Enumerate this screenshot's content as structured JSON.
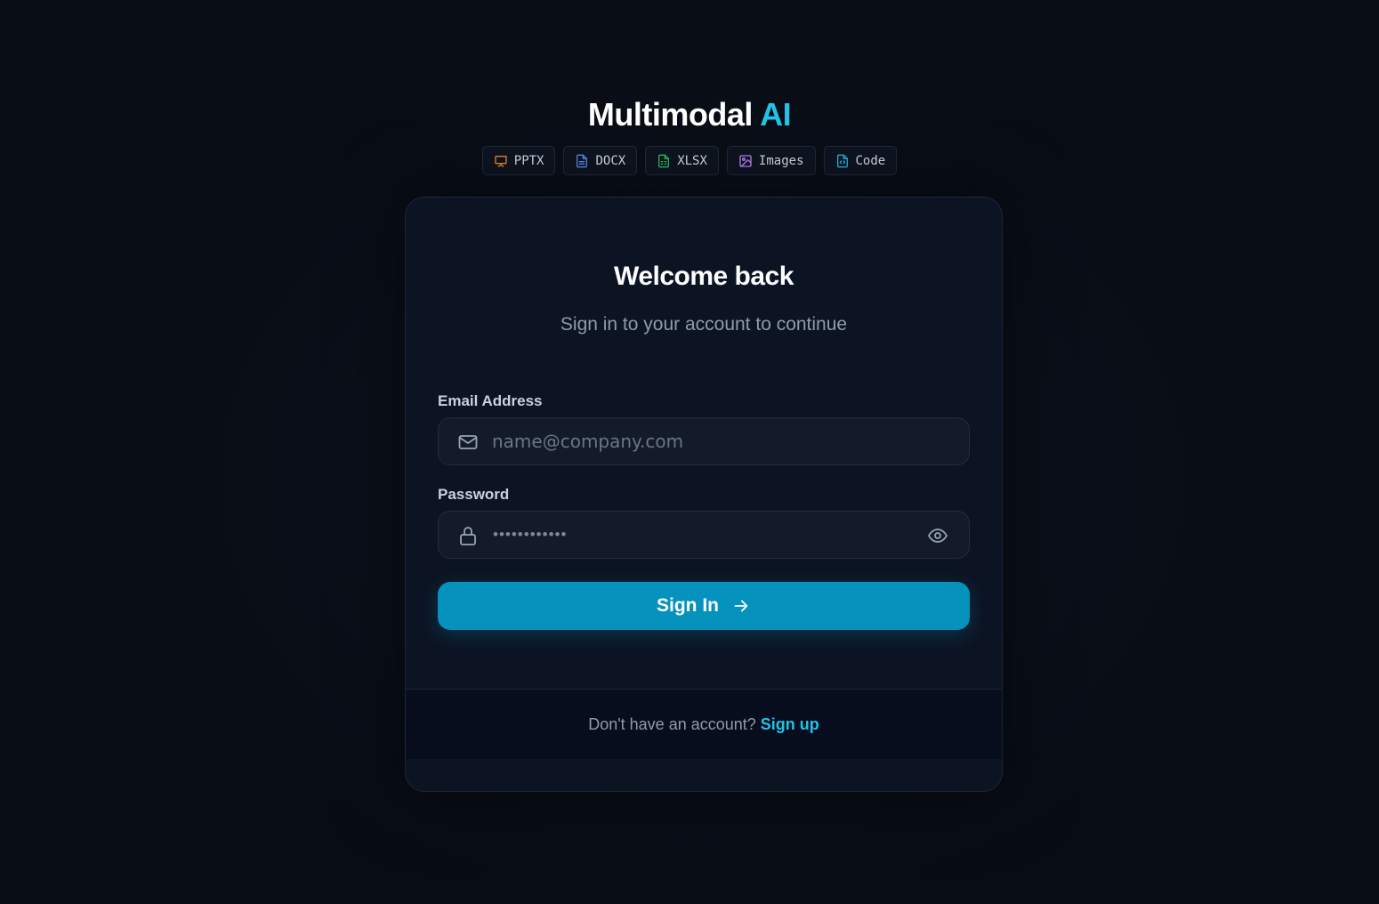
{
  "brand": {
    "name": "Multimodal",
    "accent": "AI",
    "accent_color": "#22c3e6"
  },
  "chips": [
    {
      "label": "PPTX",
      "icon": "presentation-icon",
      "color": "#f28c28"
    },
    {
      "label": "DOCX",
      "icon": "document-icon",
      "color": "#5b8def"
    },
    {
      "label": "XLSX",
      "icon": "spreadsheet-icon",
      "color": "#22c55e"
    },
    {
      "label": "Images",
      "icon": "image-icon",
      "color": "#c084fc"
    },
    {
      "label": "Code",
      "icon": "code-file-icon",
      "color": "#22b8e6"
    }
  ],
  "card": {
    "title": "Welcome back",
    "subtitle": "Sign in to your account to continue",
    "email": {
      "label": "Email Address",
      "placeholder": "name@company.com",
      "value": "",
      "icon": "mail-icon"
    },
    "password": {
      "label": "Password",
      "value_masked": "••••••••••••",
      "icon": "lock-icon",
      "toggle_icon": "eye-icon"
    },
    "submit": {
      "label": "Sign In",
      "icon": "arrow-right-icon",
      "color": "#0592bd"
    },
    "footer": {
      "prompt": "Don't have an account?",
      "link": "Sign up"
    }
  }
}
